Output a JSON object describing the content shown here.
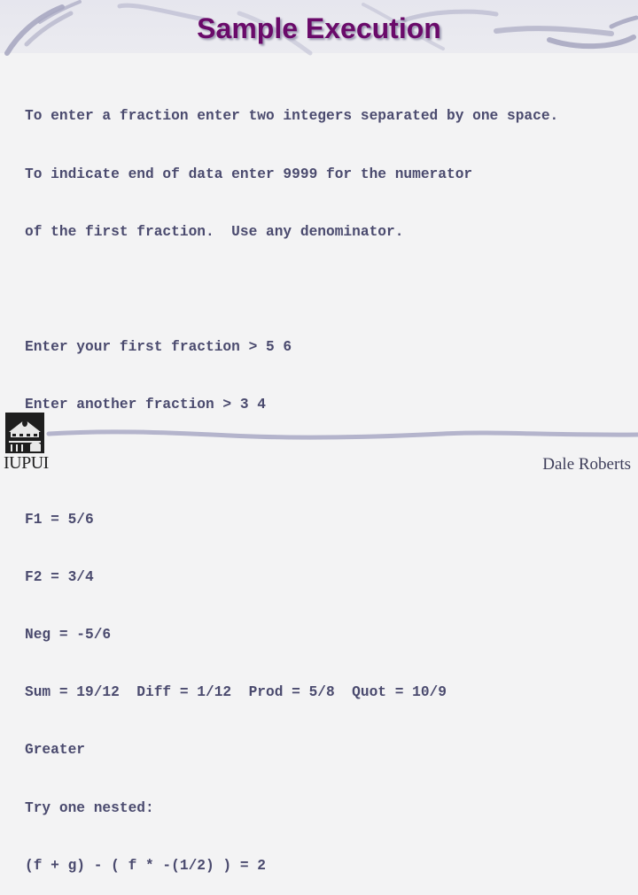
{
  "slide": {
    "title": "Sample Execution",
    "lines": [
      "To enter a fraction enter two integers separated by one space.",
      "To indicate end of data enter 9999 for the numerator",
      "of the first fraction.  Use any denominator.",
      "",
      "Enter your first fraction > 5 6",
      "Enter another fraction > 3 4",
      "",
      "F1 = 5/6",
      "F2 = 3/4",
      "Neg = -5/6",
      "Sum = 19/12  Diff = 1/12  Prod = 5/8  Quot = 10/9",
      "Greater",
      "Try one nested:",
      "(f + g) - ( f * -(1/2) ) = 2"
    ],
    "logo_text": "IUPUI",
    "author": "Dale Roberts",
    "colors": {
      "title": "#6a0a6a",
      "body_text": "#4a4a6e",
      "swoosh": "#a8a8c4",
      "background": "#f3f3f4"
    }
  }
}
